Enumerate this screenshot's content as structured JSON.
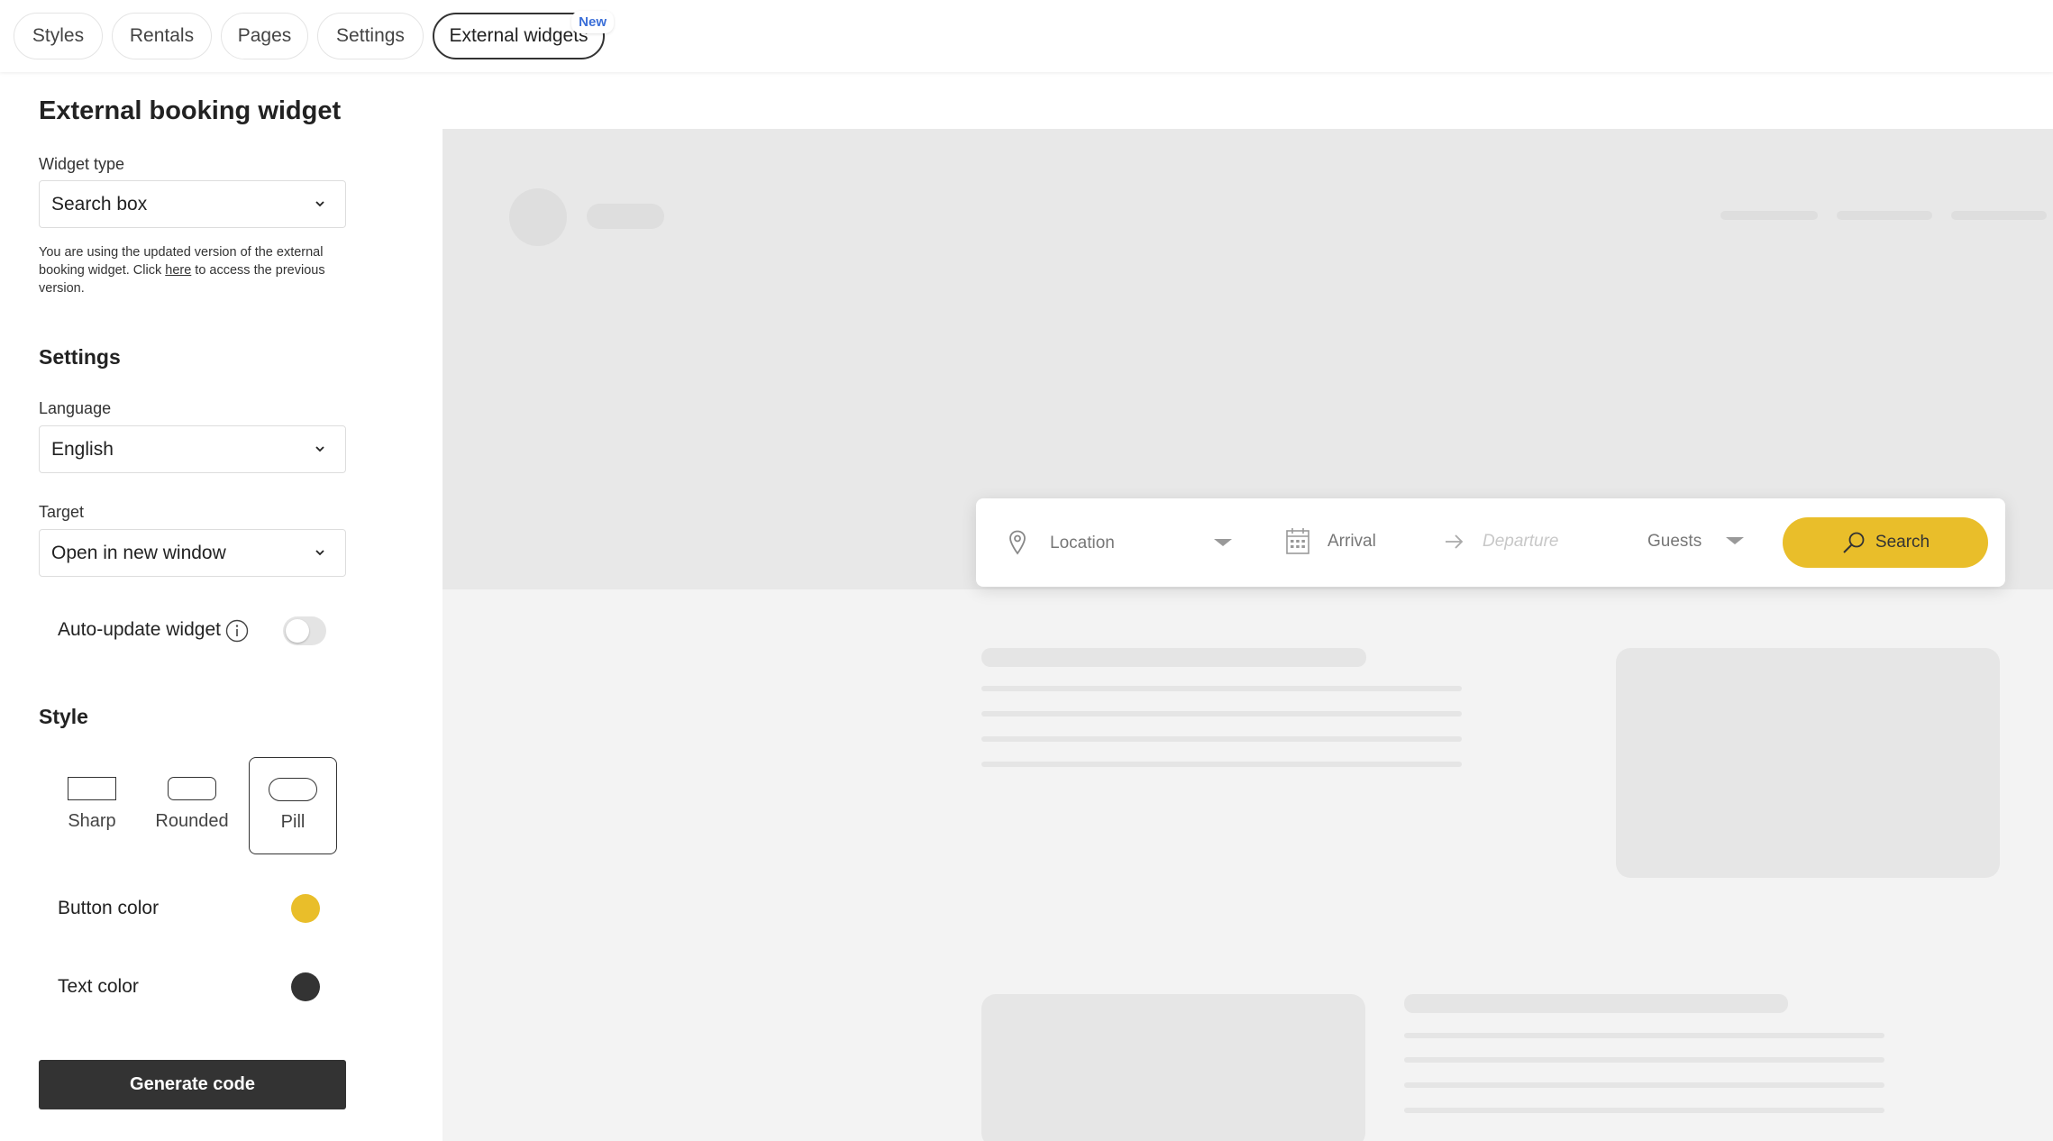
{
  "tabs": [
    {
      "label": "Styles"
    },
    {
      "label": "Rentals"
    },
    {
      "label": "Pages"
    },
    {
      "label": "Settings"
    },
    {
      "label": "External widgets",
      "badge": "New",
      "active": true
    }
  ],
  "panel": {
    "title": "External booking widget",
    "widget_type": {
      "label": "Widget type",
      "value": "Search box"
    },
    "note": {
      "before": "You are using the updated version of the external booking widget. Click ",
      "link": "here",
      "after": " to access the previous version."
    },
    "settings_heading": "Settings",
    "language": {
      "label": "Language",
      "value": "English"
    },
    "target": {
      "label": "Target",
      "value": "Open in new window"
    },
    "auto_update": {
      "label": "Auto-update widget",
      "enabled": false
    },
    "style_heading": "Style",
    "style_options": [
      {
        "label": "Sharp"
      },
      {
        "label": "Rounded"
      },
      {
        "label": "Pill",
        "selected": true
      }
    ],
    "button_color": {
      "label": "Button color",
      "value": "#E9BE2A"
    },
    "text_color": {
      "label": "Text color",
      "value": "#333333"
    },
    "generate_button": "Generate code"
  },
  "widget": {
    "location_placeholder": "Location",
    "arrival_placeholder": "Arrival",
    "departure_placeholder": "Departure",
    "guests_placeholder": "Guests",
    "search_label": "Search"
  },
  "colors": {
    "accent": "#E9BE2A",
    "dark": "#333333",
    "badge": "#3B6FD8"
  }
}
